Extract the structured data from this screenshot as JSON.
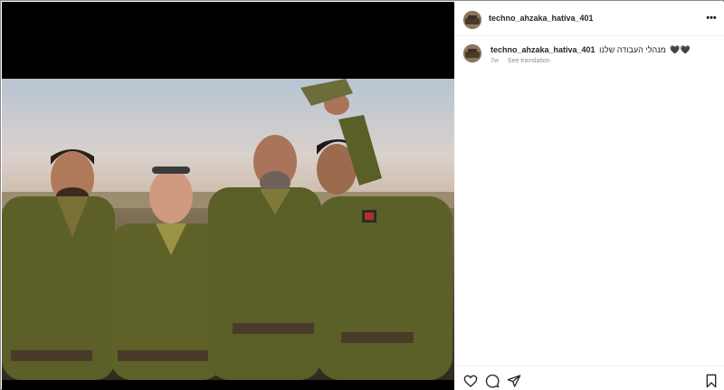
{
  "post": {
    "username": "techno_ahzaka_hativa_401",
    "more_label": "•••"
  },
  "caption": {
    "username": "techno_ahzaka_hativa_401",
    "text": "מנהלי העבודה שלנו",
    "emoji": "🖤🖤",
    "time": "7w",
    "translate_label": "See translation"
  },
  "icons": {
    "like": "heart-icon",
    "comment": "comment-icon",
    "share": "send-icon",
    "save": "bookmark-icon",
    "more": "more-icon"
  },
  "colors": {
    "uniform": "#5c5f28",
    "sky": "#cfd3dc",
    "text": "#262626",
    "muted": "#8e8e8e"
  }
}
